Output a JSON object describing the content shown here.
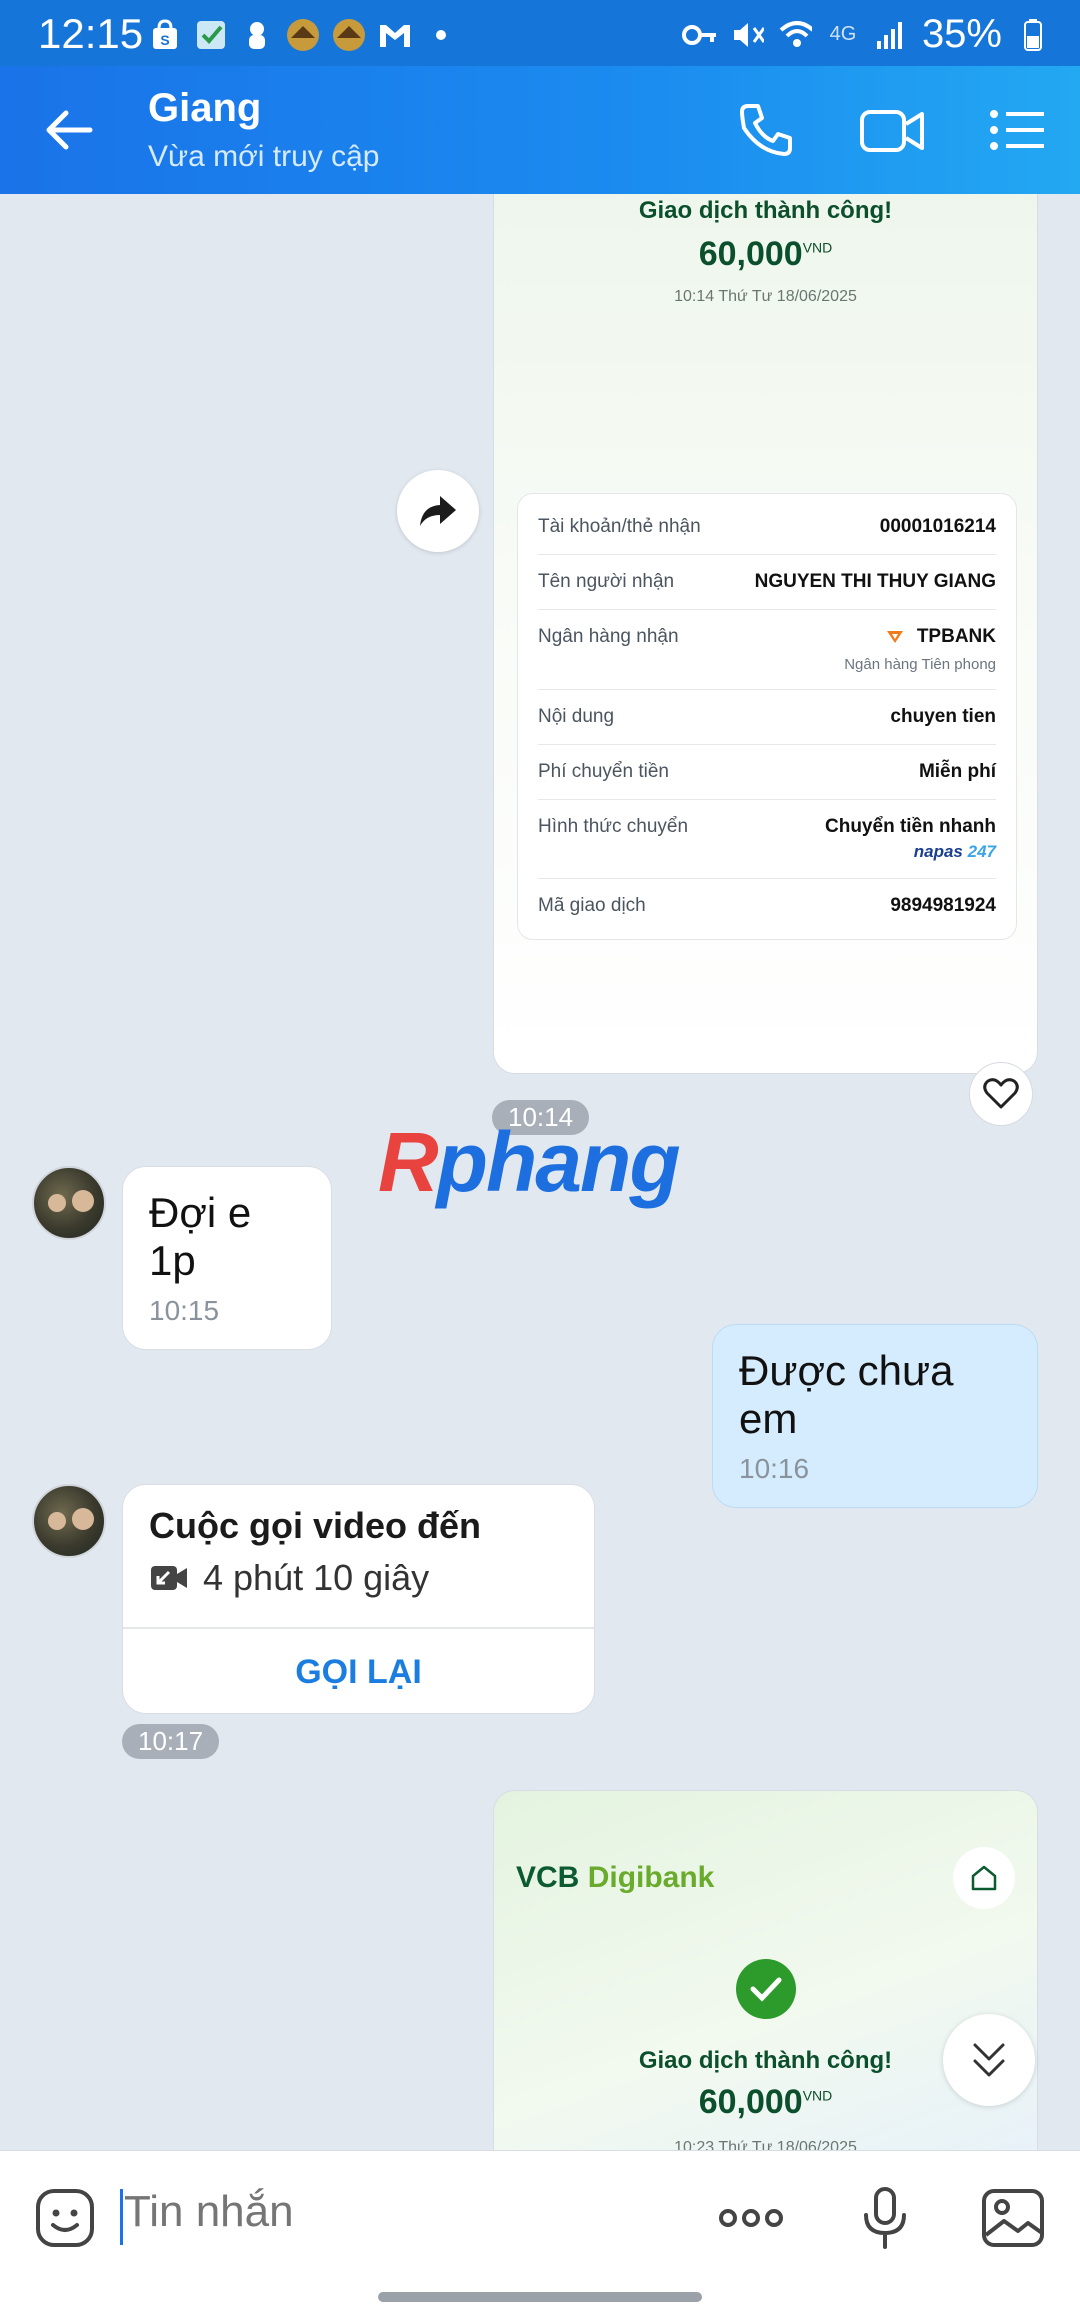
{
  "status": {
    "time": "12:15",
    "battery": "35%",
    "network": "4G"
  },
  "header": {
    "name": "Giang",
    "status": "Vừa mới truy cập"
  },
  "receipt1": {
    "title": "Giao dịch thành công!",
    "amount": "60,000",
    "currency": "VND",
    "datetime": "10:14 Thứ Tư 18/06/2025",
    "rows": [
      {
        "label": "Tài khoản/thẻ nhận",
        "value": "00001016214"
      },
      {
        "label": "Tên người nhận",
        "value": "NGUYEN THI THUY GIANG"
      },
      {
        "label": "Ngân hàng nhận",
        "value": "TPBANK",
        "sub": "Ngân hàng Tiên phong"
      },
      {
        "label": "Nội dung",
        "value": "chuyen tien"
      },
      {
        "label": "Phí chuyển tiền",
        "value": "Miễn phí"
      },
      {
        "label": "Hình thức chuyển",
        "value": "Chuyển tiền nhanh",
        "brand": "napas",
        "brand_num": "247"
      },
      {
        "label": "Mã giao dịch",
        "value": "9894981924"
      }
    ],
    "time_pill": "10:14"
  },
  "watermark": {
    "part1": "R",
    "part2": "phang"
  },
  "messages": [
    {
      "text": "Đợi e 1p",
      "time": "10:15"
    },
    {
      "text": "Được chưa em",
      "time": "10:16"
    }
  ],
  "call": {
    "title": "Cuộc gọi video đến",
    "duration": "4 phút 10 giây",
    "action": "GỌI LẠI",
    "time_pill": "10:17"
  },
  "receipt2": {
    "logo_part1": "VCB",
    "logo_part2": "Digibank",
    "title": "Giao dịch thành công!",
    "amount": "60,000",
    "currency": "VND",
    "datetime": "10:23 Thứ Tư 18/06/2025"
  },
  "input": {
    "placeholder": "Tin nhắn"
  },
  "colors": {
    "header_blue": "#1a73e8",
    "accent_blue": "#1a7ddf",
    "success_green": "#2d9a2c"
  }
}
